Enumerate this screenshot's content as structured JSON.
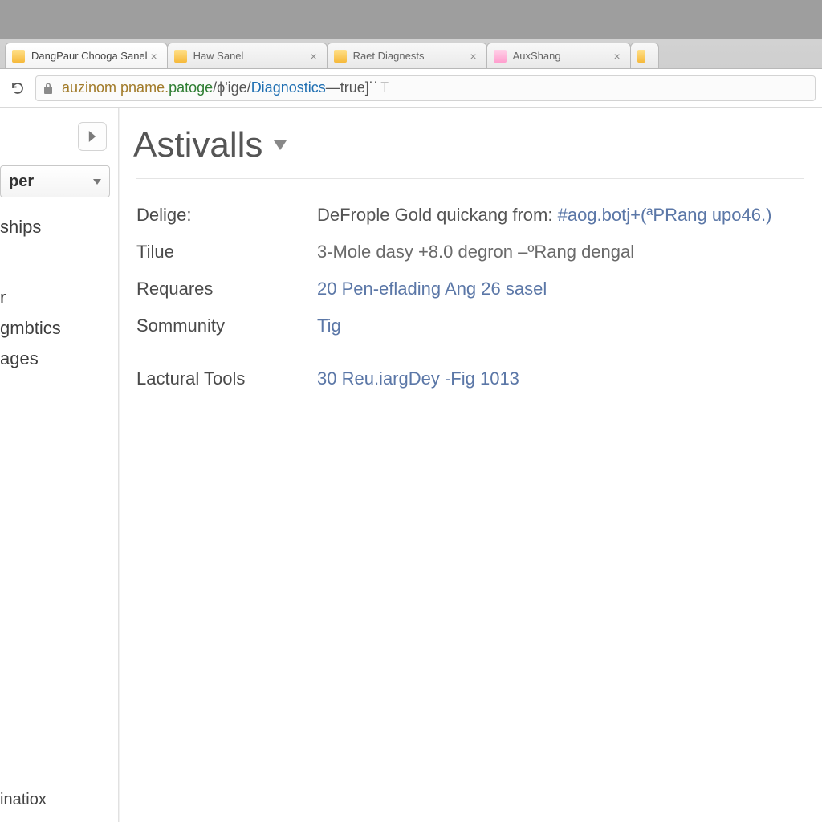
{
  "tabs": [
    {
      "label": "DangPaur Chooga Sanel",
      "favicon": "fav-yellow"
    },
    {
      "label": "Haw Sanel",
      "favicon": "fav-yellow"
    },
    {
      "label": "Raet Diagnests",
      "favicon": "fav-yellow"
    },
    {
      "label": "AuxShang",
      "favicon": "fav-pink"
    },
    {
      "label": "",
      "favicon": "fav-yellow"
    }
  ],
  "address": {
    "host": "auzinom pname.",
    "mid": " patoge ",
    "sep1": "/ϕ'ige/",
    "path": "Diagnostics",
    "tail": "—true]˙˙"
  },
  "sidebar": {
    "select_label": "per",
    "items": [
      "ships",
      "",
      "",
      ""
    ],
    "items2": [
      "r",
      "gmbtics",
      "ages"
    ],
    "footer": "inatiox"
  },
  "main": {
    "title": "Astivalls",
    "rows": [
      {
        "label": "Delige:",
        "lead": "DeFrople Gold quickang from:",
        "blue": "#aog.botj+(ªPRang upo46.)"
      },
      {
        "label": "Tilue",
        "value": "3-Mole dasy +8.0 degron –ºRang dengal",
        "plain": true
      },
      {
        "label": "Requares",
        "value": "20 Pen-eflading Ang 26 sasel"
      },
      {
        "label": "Sommunity",
        "value": "Tig"
      },
      {
        "label": "Lactural Tools",
        "value": "30 Reu.iargDey  -Fig 1013"
      }
    ]
  }
}
